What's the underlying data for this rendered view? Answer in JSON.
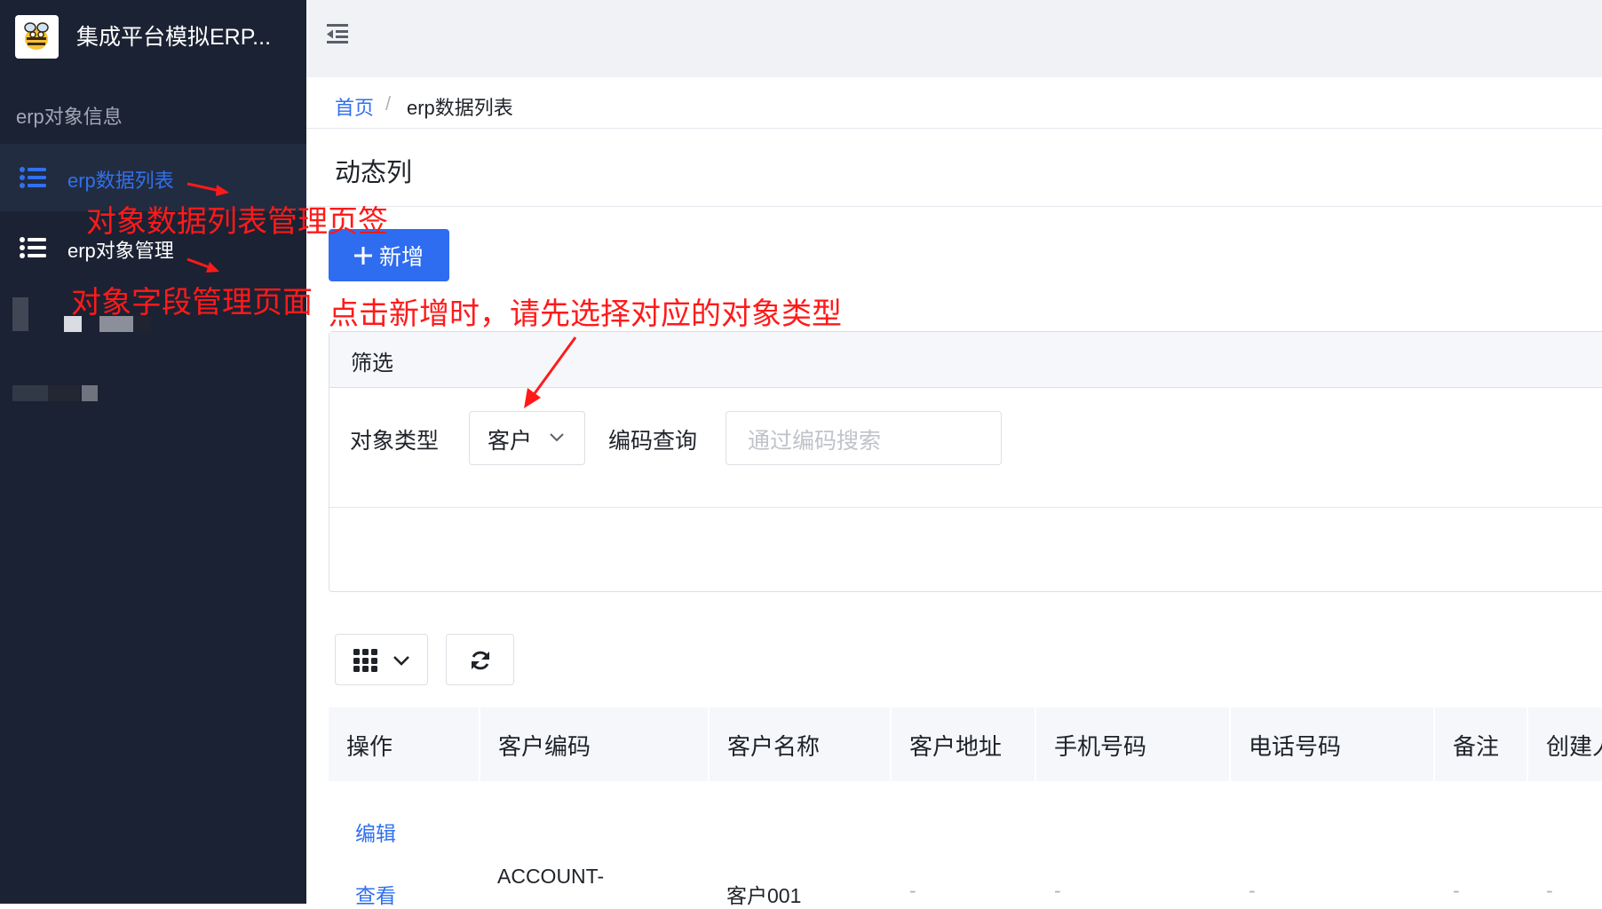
{
  "sidebar": {
    "app_title": "集成平台模拟ERP...",
    "group_label": "erp对象信息",
    "items": [
      {
        "label": "erp数据列表",
        "active": true
      },
      {
        "label": "erp对象管理",
        "active": false
      }
    ]
  },
  "breadcrumb": {
    "home": "首页",
    "separator": "/",
    "current": "erp数据列表"
  },
  "page": {
    "title": "动态列"
  },
  "toolbar": {
    "add_label": "新增"
  },
  "filter": {
    "title": "筛选",
    "object_type_label": "对象类型",
    "object_type_value": "客户",
    "code_label": "编码查询",
    "code_placeholder": "通过编码搜索"
  },
  "table": {
    "headers": [
      "操作",
      "客户编码",
      "客户名称",
      "客户地址",
      "手机号码",
      "电话号码",
      "备注",
      "创建人"
    ],
    "rows": [
      {
        "actions": [
          "编辑",
          "查看"
        ],
        "code": "ACCOUNT-",
        "name": "客户001",
        "address": "-",
        "mobile": "-",
        "phone": "-",
        "remark": "-",
        "creator": "-"
      }
    ]
  },
  "annotations": {
    "tab_note": "对象数据列表管理页签",
    "field_note": "对象字段管理页面",
    "add_note": "点击新增时，请先选择对应的对象类型"
  },
  "colors": {
    "sidebar_bg": "#1b2233",
    "primary": "#2e6cf0",
    "annotation": "#ff1a1a"
  }
}
